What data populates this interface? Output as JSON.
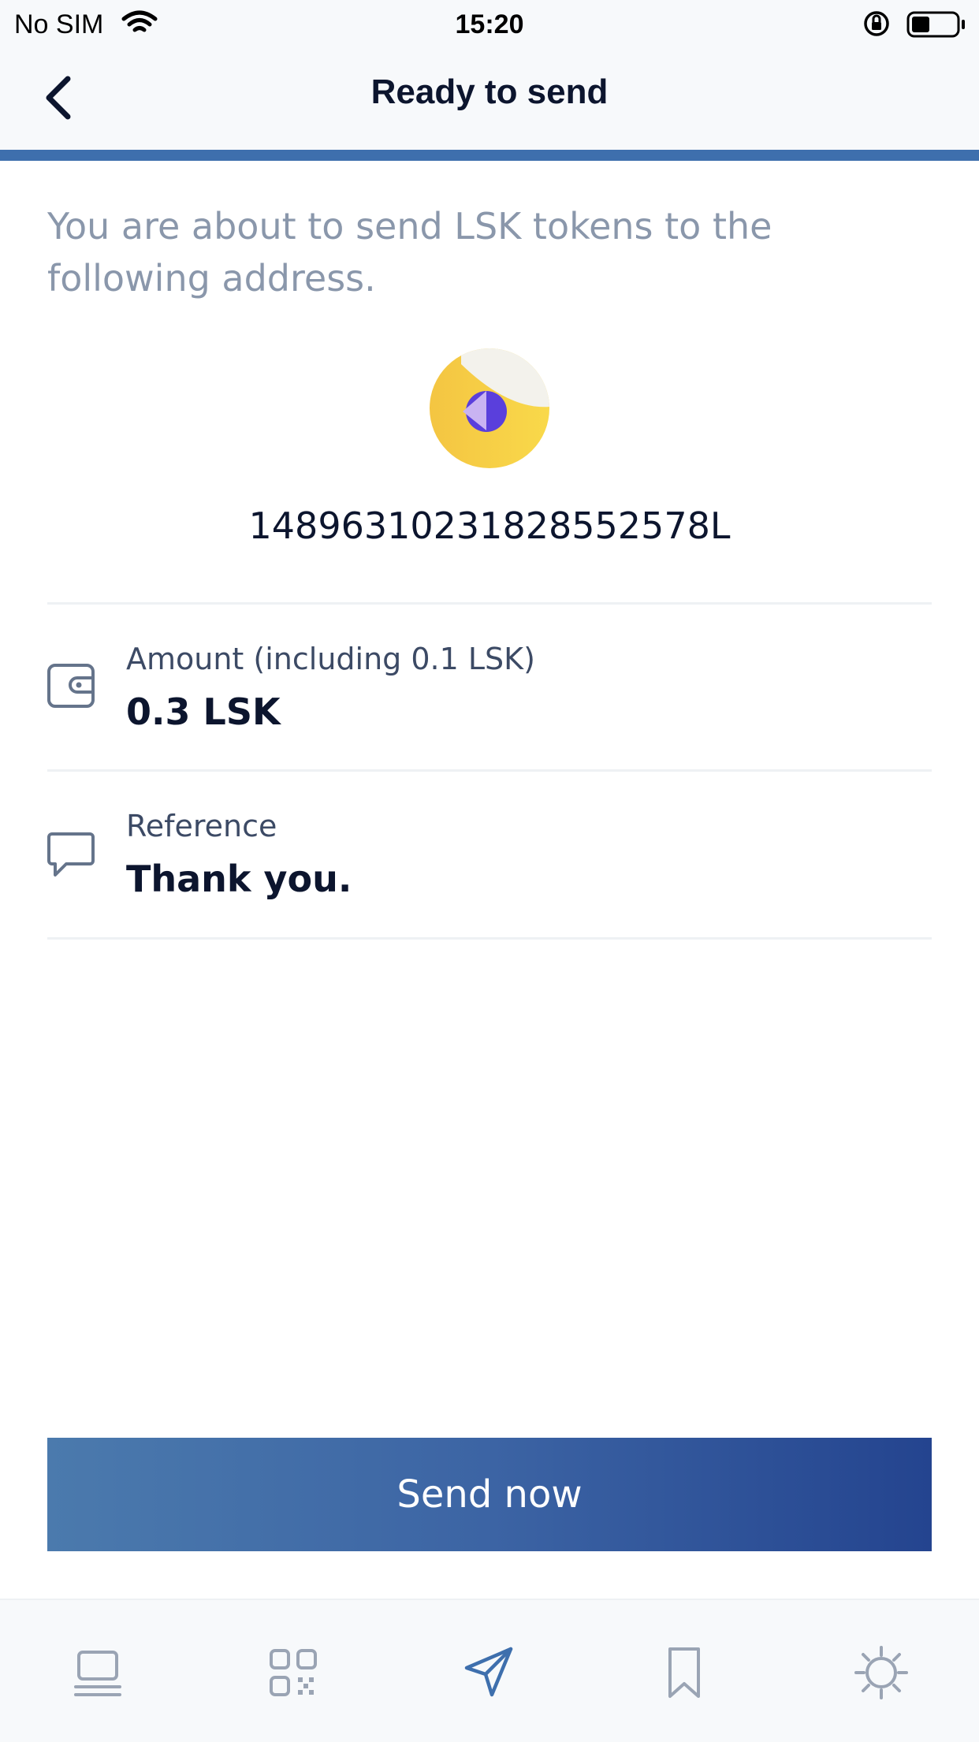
{
  "status_bar": {
    "carrier": "No SIM",
    "time": "15:20",
    "battery_level": 0.4
  },
  "header": {
    "title": "Ready to send"
  },
  "intro_text": "You are about to send LSK tokens to the following address.",
  "recipient": {
    "address": "14896310231828552578L"
  },
  "details": {
    "amount_label": "Amount (including 0.1 LSK)",
    "amount_value": "0.3 LSK",
    "reference_label": "Reference",
    "reference_value": "Thank you."
  },
  "send_button_label": "Send now",
  "tabs": [
    {
      "icon": "home-icon",
      "active": false
    },
    {
      "icon": "qr-code-icon",
      "active": false
    },
    {
      "icon": "send-icon",
      "active": true
    },
    {
      "icon": "bookmark-icon",
      "active": false
    },
    {
      "icon": "settings-icon",
      "active": false
    }
  ],
  "colors": {
    "accent": "#3e6fad",
    "button_gradient_start": "#4b7aad",
    "button_gradient_end": "#24448f",
    "muted_text": "#8a97ab",
    "icon_inactive": "#9aa4b4"
  }
}
